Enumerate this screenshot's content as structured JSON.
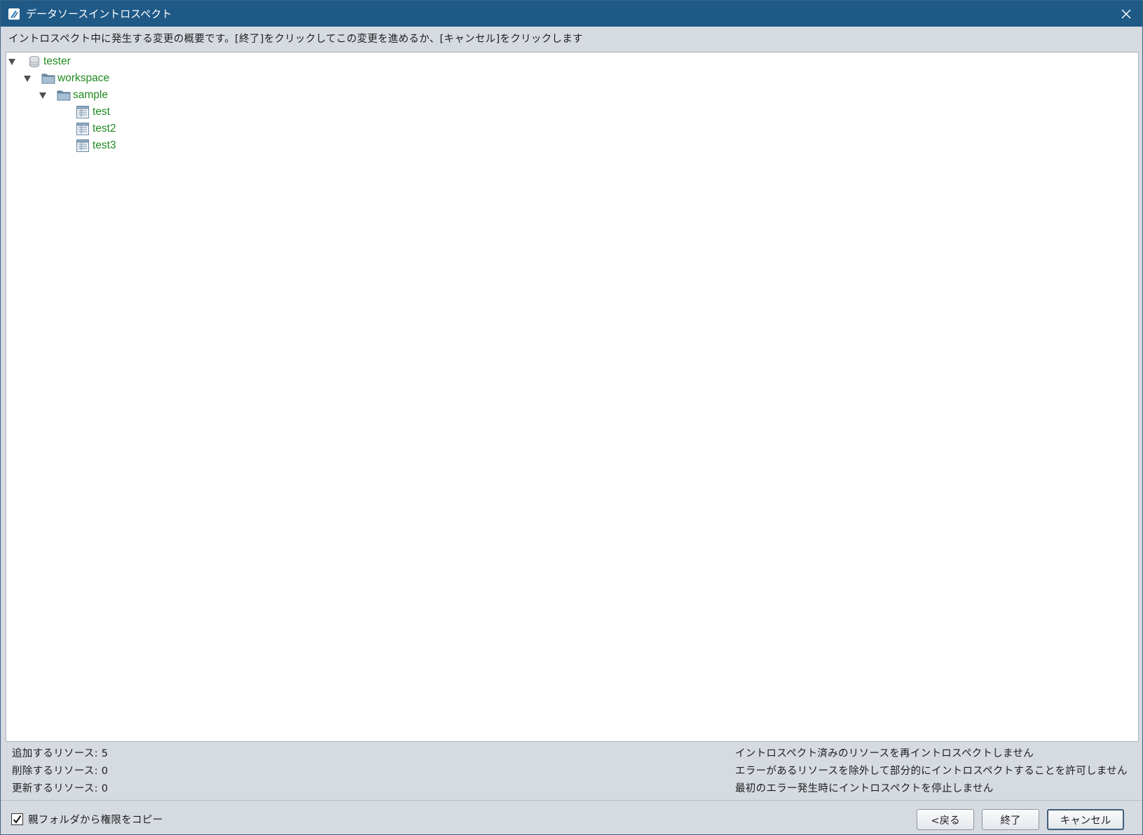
{
  "window": {
    "title": "データソースイントロスペクト",
    "accent_color": "#1f5a87"
  },
  "description": "イントロスペクト中に発生する変更の概要です。[終了]をクリックしてこの変更を進めるか、[キャンセル]をクリックします",
  "tree": {
    "label_color": "#1f8a1f",
    "nodes": [
      {
        "label": "tester",
        "icon": "database-icon",
        "expanded": true
      },
      {
        "label": "workspace",
        "icon": "folder-icon",
        "expanded": true
      },
      {
        "label": "sample",
        "icon": "folder-icon",
        "expanded": true
      },
      {
        "label": "test",
        "icon": "table-icon"
      },
      {
        "label": "test2",
        "icon": "table-icon"
      },
      {
        "label": "test3",
        "icon": "table-icon"
      }
    ]
  },
  "summary": {
    "add": "追加するリソース: 5",
    "delete": "削除するリソース: 0",
    "update": "更新するリソース: 0",
    "options": [
      "イントロスペクト済みのリソースを再イントロスペクトしません",
      "エラーがあるリソースを除外して部分的にイントロスペクトすることを許可しません",
      "最初のエラー発生時にイントロスペクトを停止しません"
    ]
  },
  "copy_permissions": {
    "label": "親フォルダから権限をコピー",
    "checked": true
  },
  "buttons": {
    "back": "<戻る",
    "finish": "終了",
    "cancel": "キャンセル"
  }
}
